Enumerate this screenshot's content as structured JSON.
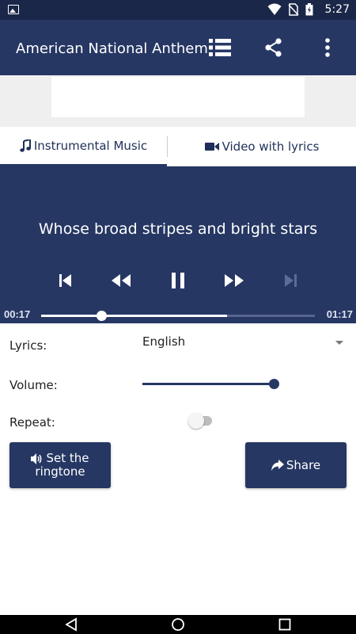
{
  "status_bar": {
    "time": "5:27",
    "icons": [
      "image-icon",
      "wifi-icon",
      "no-sim-icon",
      "battery-charging-icon"
    ]
  },
  "app_bar": {
    "title": "American National Anthem",
    "actions": [
      "list-icon",
      "share-icon",
      "more-vert-icon"
    ]
  },
  "tabs": [
    {
      "label": "Instrumental Music",
      "icon": "music-note-icon",
      "selected": true
    },
    {
      "label": "Video with lyrics",
      "icon": "videocam-icon",
      "selected": false
    }
  ],
  "player": {
    "lyric_line": "Whose broad stripes and bright stars",
    "controls": [
      "skip-previous-icon",
      "rewind-icon",
      "pause-icon",
      "fast-forward-icon",
      "skip-next-icon"
    ],
    "elapsed": "00:17",
    "duration": "01:17",
    "progress_fraction": 0.22,
    "buffered_fraction": 0.68
  },
  "settings": {
    "lyrics_label": "Lyrics:",
    "lyrics_value": "English",
    "volume_label": "Volume:",
    "volume_fraction": 1.0,
    "repeat_label": "Repeat:",
    "repeat_on": false
  },
  "buttons": {
    "ringtone_line1": "Set the",
    "ringtone_line2": "ringtone",
    "share_label": "Share"
  },
  "colors": {
    "primary": "#263763",
    "status_bar": "#1b2748",
    "ad_background": "#efefef"
  }
}
